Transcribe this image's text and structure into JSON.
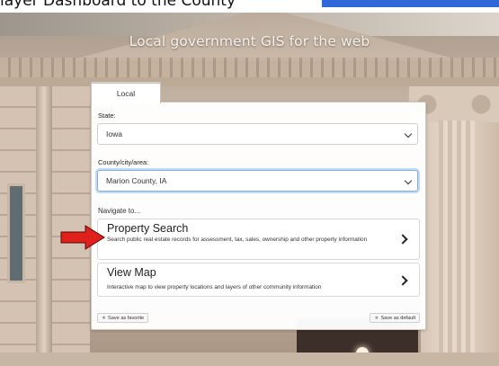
{
  "top_caption": "layer Dashboard to the County",
  "hero": {
    "title": "Local government GIS for the web"
  },
  "tabs": [
    {
      "label": "Local"
    }
  ],
  "state": {
    "label": "State:",
    "value": "Iowa"
  },
  "county": {
    "label": "County/city/area:",
    "value": "Marion County, IA"
  },
  "navigate_label": "Navigate to...",
  "cards": [
    {
      "title": "Property Search",
      "description": "Search public real estate records for assessment, tax, sales, ownership and other property information"
    },
    {
      "title": "View Map",
      "description": "Interactive map to view property locations and layers of other community information"
    }
  ],
  "footer": {
    "save_favorite": "Save as favorite",
    "save_default": "Save as default"
  },
  "colors": {
    "highlight": "#2f68d8",
    "arrow": "#e0201b",
    "focus_ring": "#7fb0e0"
  },
  "icons": {
    "select": "chevron-down-icon",
    "card": "chevron-right-icon",
    "footer": "star-icon"
  }
}
